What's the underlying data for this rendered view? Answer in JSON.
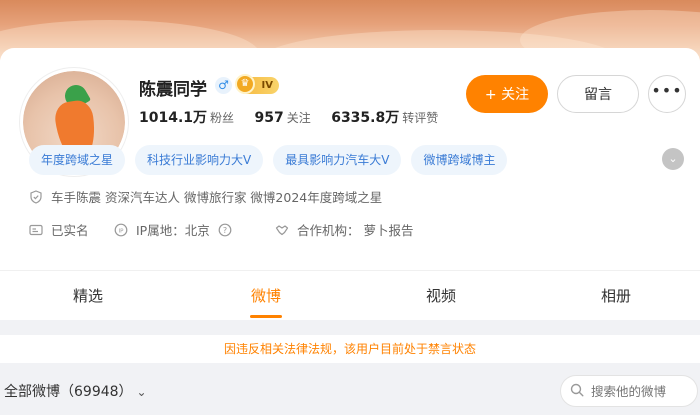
{
  "profile": {
    "name": "陈震同学",
    "vip_level": "IV",
    "verify_mark": "V",
    "stats": [
      {
        "value": "1014.1万",
        "label": "粉丝"
      },
      {
        "value": "957",
        "label": "关注"
      },
      {
        "value": "6335.8万",
        "label": "转评赞"
      }
    ]
  },
  "actions": {
    "follow": "+ 关注",
    "message": "留言",
    "more": "•••"
  },
  "tags": [
    "年度跨域之星",
    "科技行业影响力大V",
    "最具影响力汽车大V",
    "微博跨域博主"
  ],
  "info": {
    "bio": "车手陈震 资深汽车达人 微博旅行家 微博2024年度跨域之星",
    "real_name": "已实名",
    "ip_location": "IP属地：北京",
    "cooperation": "合作机构： 萝卜报告"
  },
  "tabs": [
    "精选",
    "微博",
    "视频",
    "相册"
  ],
  "active_tab": "微博",
  "notice": "因违反相关法律法规，该用户目前处于禁言状态",
  "feed": {
    "title": "全部微博（69948）",
    "search_placeholder": "搜索他的微博"
  },
  "colors": {
    "accent": "#ff8200",
    "tag_text": "#3a7bd5",
    "tag_bg": "#eef5fc"
  }
}
